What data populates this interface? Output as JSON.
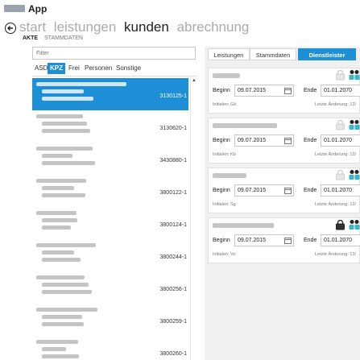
{
  "app": {
    "title": "App"
  },
  "nav": {
    "crumbs": [
      "start",
      "leistungen",
      "kunden",
      "abrechnung"
    ],
    "active_index": 2,
    "subnav": [
      "AKTE",
      "STAMMDATEN"
    ]
  },
  "left": {
    "filter_placeholder": "Filter",
    "tabs": [
      "ASD",
      "KPZ",
      "Frei",
      "Personen",
      "Sonstige"
    ],
    "active_tab": "KPZ",
    "rows": [
      {
        "number": "3130125-1",
        "selected": true
      },
      {
        "number": "3130620-1"
      },
      {
        "number": "3430880-1"
      },
      {
        "number": "3800122-1"
      },
      {
        "number": "3800124-1"
      },
      {
        "number": "3800244-1"
      },
      {
        "number": "3800256-1"
      },
      {
        "number": "3800259-1"
      },
      {
        "number": "3800260-1"
      }
    ]
  },
  "right": {
    "tabs": [
      "Leistungen",
      "Stammdaten",
      "Dienstleister"
    ],
    "active_tab": "Dienstleister",
    "begin_label": "Beginn",
    "end_label": "Ende",
    "cards": [
      {
        "begin": "09.07.2015",
        "end": "01.01.2070",
        "initials": "Initialen: Gö",
        "last_change": "Letzte Änderung: 12/",
        "locked": false
      },
      {
        "begin": "09.07.2015",
        "end": "01.01.2070",
        "initials": "Initialen: Kb",
        "last_change": "Letzte Änderung: 12/",
        "locked": false
      },
      {
        "begin": "09.07.2015",
        "end": "01.01.2070",
        "initials": "Initialen: Sg",
        "last_change": "Letzte Änderung: 12/",
        "locked": false
      },
      {
        "begin": "09.07.2015",
        "end": "01.01.2070",
        "initials": "Initialen: Vo",
        "last_change": "Letzte Änderung: 12/",
        "locked": true
      }
    ]
  },
  "colors": {
    "accent": "#1e8fd6",
    "panel_bg": "#f0f0f0"
  }
}
